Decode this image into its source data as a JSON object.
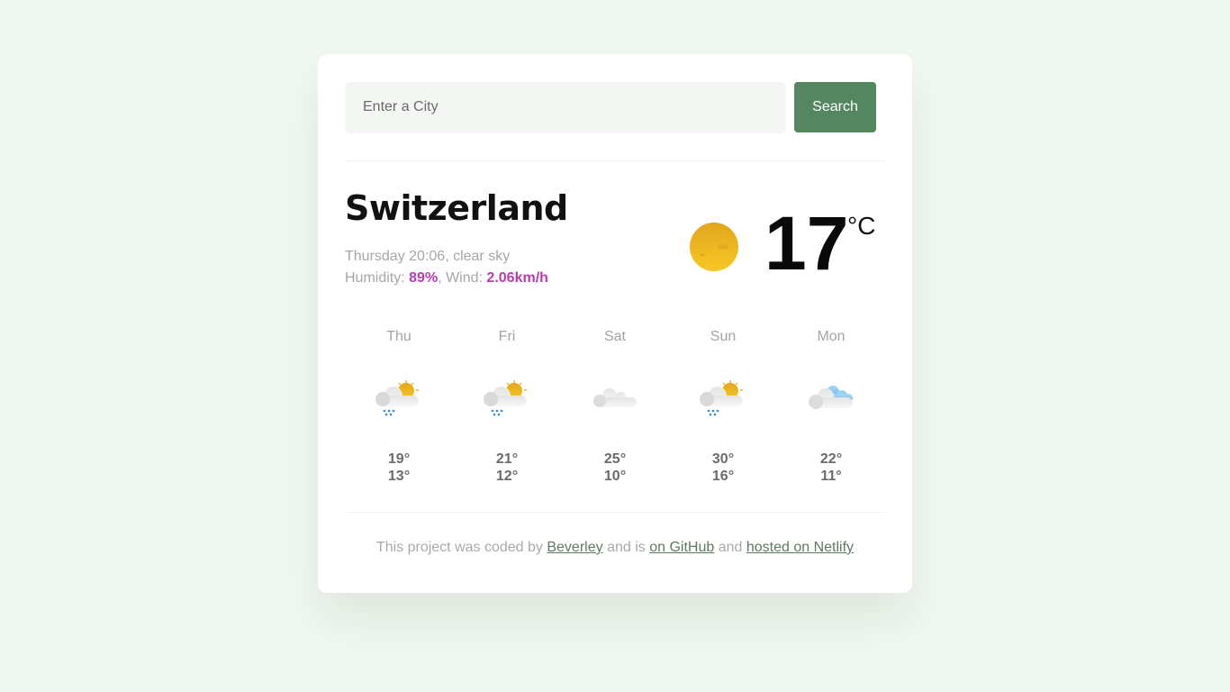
{
  "search": {
    "placeholder": "Enter a City",
    "value": "",
    "button_label": "Search"
  },
  "current": {
    "city": "Switzerland",
    "datetime": "Thursday 20:06",
    "description": "clear sky",
    "humidity_label": "Humidity:",
    "humidity": "89%",
    "wind_label": "Wind:",
    "wind": "2.06km/h",
    "icon": "clear-sky-sun-icon",
    "temperature": "17",
    "unit": "°C"
  },
  "forecast": [
    {
      "day": "Thu",
      "icon": "rain-partly-sunny-icon",
      "max": "19°",
      "min": "13°"
    },
    {
      "day": "Fri",
      "icon": "rain-partly-sunny-icon",
      "max": "21°",
      "min": "12°"
    },
    {
      "day": "Sat",
      "icon": "cloudy-icon",
      "max": "25°",
      "min": "10°"
    },
    {
      "day": "Sun",
      "icon": "rain-partly-sunny-icon",
      "max": "30°",
      "min": "16°"
    },
    {
      "day": "Mon",
      "icon": "broken-clouds-icon",
      "max": "22°",
      "min": "11°"
    }
  ],
  "footer": {
    "text1": "This project was coded by",
    "link1": "Beverley",
    "text2": "and is",
    "link2": "on GitHub",
    "text3": "and",
    "link3": "hosted on Netlify"
  },
  "colors": {
    "accent": "#548760",
    "highlight": "#b83bb0",
    "background": "#f0f7f0"
  }
}
